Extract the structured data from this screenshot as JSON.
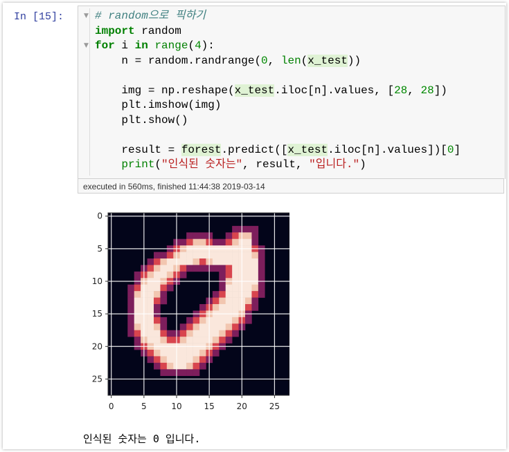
{
  "cell": {
    "prompt": "In [15]:",
    "code": {
      "comment": "# random으로 픽하기",
      "line2": {
        "kw": "import",
        "rest": " random"
      },
      "line3": {
        "kw_for": "for",
        "var": " i ",
        "kw_in": "in",
        "sp": " ",
        "range": "range",
        "open": "(",
        "num": "4",
        "close": "):"
      },
      "line4": {
        "pre": "    n = random.randrange(",
        "num": "0",
        "mid": ", ",
        "len": "len",
        "open": "(",
        "hl": "x_test",
        "close": "))"
      },
      "line6": {
        "pre": "    img = np.reshape(",
        "hl": "x_test",
        "mid": ".iloc[n].values, [",
        "n1": "28",
        "comma": ", ",
        "n2": "28",
        "close": "])"
      },
      "line7": "    plt.imshow(img)",
      "line8": "    plt.show()",
      "line10": {
        "pre": "    result = ",
        "hl1": "forest",
        "mid1": ".predict([",
        "hl2": "x_test",
        "mid2": ".iloc[n].values])[",
        "num": "0",
        "close": "]"
      },
      "line11": {
        "pre": "    ",
        "print": "print",
        "open": "(",
        "s1": "\"인식된 숫자는\"",
        "mid": ", result, ",
        "s2": "\"입니다.\"",
        "close": ")"
      }
    },
    "executed": "executed in 560ms, finished 11:44:38 2019-03-14"
  },
  "output": {
    "result_text": "인식된 숫자는 0 입니다."
  },
  "chart_data": {
    "type": "heatmap",
    "title": "",
    "xlabel": "",
    "ylabel": "",
    "xticks": [
      "0",
      "5",
      "10",
      "15",
      "20",
      "25"
    ],
    "yticks": [
      "0",
      "5",
      "10",
      "15",
      "20",
      "25"
    ],
    "xlim": [
      -0.5,
      27.5
    ],
    "ylim": [
      27.5,
      -0.5
    ],
    "grid": true,
    "colormap": "rocket",
    "description_values": "28x28 grayscale MNIST digit (0) rendered with a dark-to-light colormap",
    "strokes": [
      {
        "row": 3,
        "cols": [
          20,
          21
        ]
      },
      {
        "row": 4,
        "cols": [
          13,
          14,
          19,
          20,
          21
        ]
      },
      {
        "row": 5,
        "cols": [
          11,
          12,
          13,
          14,
          15,
          16,
          17,
          18,
          19,
          20,
          21
        ]
      },
      {
        "row": 6,
        "cols": [
          10,
          11,
          12,
          13,
          14,
          15,
          16,
          17,
          18,
          19,
          20,
          21,
          22
        ]
      },
      {
        "row": 7,
        "cols": [
          8,
          9,
          10,
          11,
          12,
          13,
          15,
          16,
          17,
          18,
          19,
          20,
          21,
          22
        ]
      },
      {
        "row": 8,
        "cols": [
          7,
          8,
          9,
          10,
          19,
          20,
          21,
          22
        ]
      },
      {
        "row": 9,
        "cols": [
          6,
          7,
          8,
          9,
          19,
          20,
          21,
          22
        ]
      },
      {
        "row": 10,
        "cols": [
          5,
          6,
          7,
          8,
          18,
          19,
          20,
          21,
          22
        ]
      },
      {
        "row": 11,
        "cols": [
          5,
          6,
          7,
          18,
          19,
          20,
          21,
          22
        ]
      },
      {
        "row": 12,
        "cols": [
          4,
          5,
          6,
          7,
          18,
          19,
          20,
          21
        ]
      },
      {
        "row": 13,
        "cols": [
          4,
          5,
          6,
          17,
          18,
          19,
          20,
          21
        ]
      },
      {
        "row": 14,
        "cols": [
          4,
          5,
          6,
          16,
          17,
          18,
          19,
          20
        ]
      },
      {
        "row": 15,
        "cols": [
          4,
          5,
          6,
          15,
          16,
          17,
          18,
          19,
          20
        ]
      },
      {
        "row": 16,
        "cols": [
          4,
          5,
          6,
          14,
          15,
          16,
          17,
          18,
          19
        ]
      },
      {
        "row": 17,
        "cols": [
          4,
          5,
          6,
          7,
          13,
          14,
          15,
          16,
          17,
          18
        ]
      },
      {
        "row": 18,
        "cols": [
          5,
          6,
          7,
          12,
          13,
          14,
          15,
          16,
          17
        ]
      },
      {
        "row": 19,
        "cols": [
          5,
          6,
          7,
          8,
          11,
          12,
          13,
          14,
          15,
          16
        ]
      },
      {
        "row": 20,
        "cols": [
          6,
          7,
          8,
          9,
          10,
          11,
          12,
          13,
          14,
          15
        ]
      },
      {
        "row": 21,
        "cols": [
          7,
          8,
          9,
          10,
          11,
          12,
          13,
          14
        ]
      },
      {
        "row": 22,
        "cols": [
          8,
          9,
          10,
          11,
          12,
          13
        ]
      },
      {
        "row": 23,
        "cols": [
          9,
          10,
          11,
          12
        ]
      }
    ]
  },
  "colors": {
    "prompt": "#303f9f",
    "keyword": "#008000",
    "comment": "#408080",
    "string": "#ba2121",
    "highlight": "#dff2d4",
    "cell_bg": "#f7f7f7",
    "plot_bg": "#03051a"
  }
}
